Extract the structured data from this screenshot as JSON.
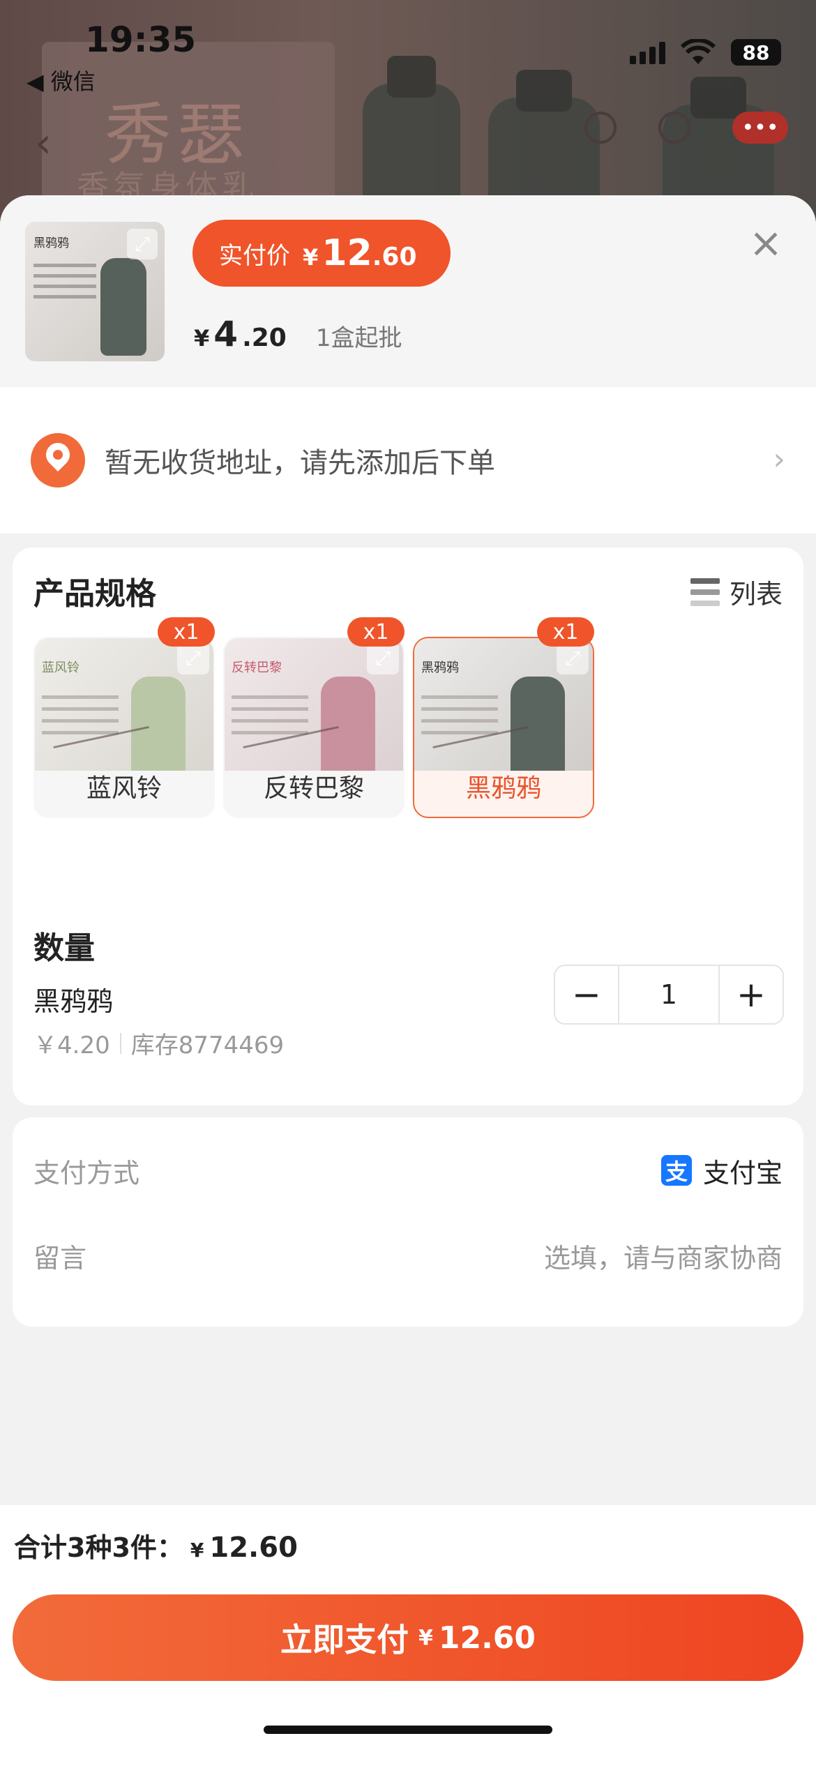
{
  "status_bar": {
    "time": "19:35",
    "back_app": "◀ 微信",
    "battery": "88"
  },
  "background_page": {
    "poster_title": "秀瑟",
    "poster_subtitle": "香氛身体乳"
  },
  "header": {
    "thumb_title": "黑鸦鸦",
    "pay_badge_label": "实付价",
    "pay_currency": "¥",
    "pay_int": "12",
    "pay_dec": ".60",
    "unit_currency": "¥",
    "unit_int": "4",
    "unit_dec": ".20",
    "moq": "1盒起批",
    "close": "×"
  },
  "address": {
    "text": "暂无收货地址，请先添加后下单",
    "chevron": "›"
  },
  "spec": {
    "title": "产品规格",
    "list_label": "列表",
    "variants": [
      {
        "name": "蓝风铃",
        "qty": "x1",
        "img_title": "蓝风铃",
        "color": "#b9c7a6",
        "selected": false
      },
      {
        "name": "反转巴黎",
        "qty": "x1",
        "img_title": "反转巴黎",
        "color": "#c9919e",
        "selected": false
      },
      {
        "name": "黑鸦鸦",
        "qty": "x1",
        "img_title": "黑鸦鸦",
        "color": "#5b655f",
        "selected": true
      }
    ]
  },
  "quantity": {
    "title": "数量",
    "item_name": "黑鸦鸦",
    "price": "￥4.20",
    "stock": "库存8774469",
    "value": "1",
    "minus": "−",
    "plus": "+"
  },
  "payment": {
    "method_label": "支付方式",
    "method_value": "支付宝",
    "alipay_glyph": "支",
    "note_label": "留言",
    "note_placeholder": "选填，请与商家协商"
  },
  "footer": {
    "total_label": "合计3种3件：",
    "total_currency": "¥",
    "total_amount": "12.60",
    "pay_button_label": "立即支付",
    "pay_button_currency": "¥",
    "pay_button_amount": "12.60"
  }
}
